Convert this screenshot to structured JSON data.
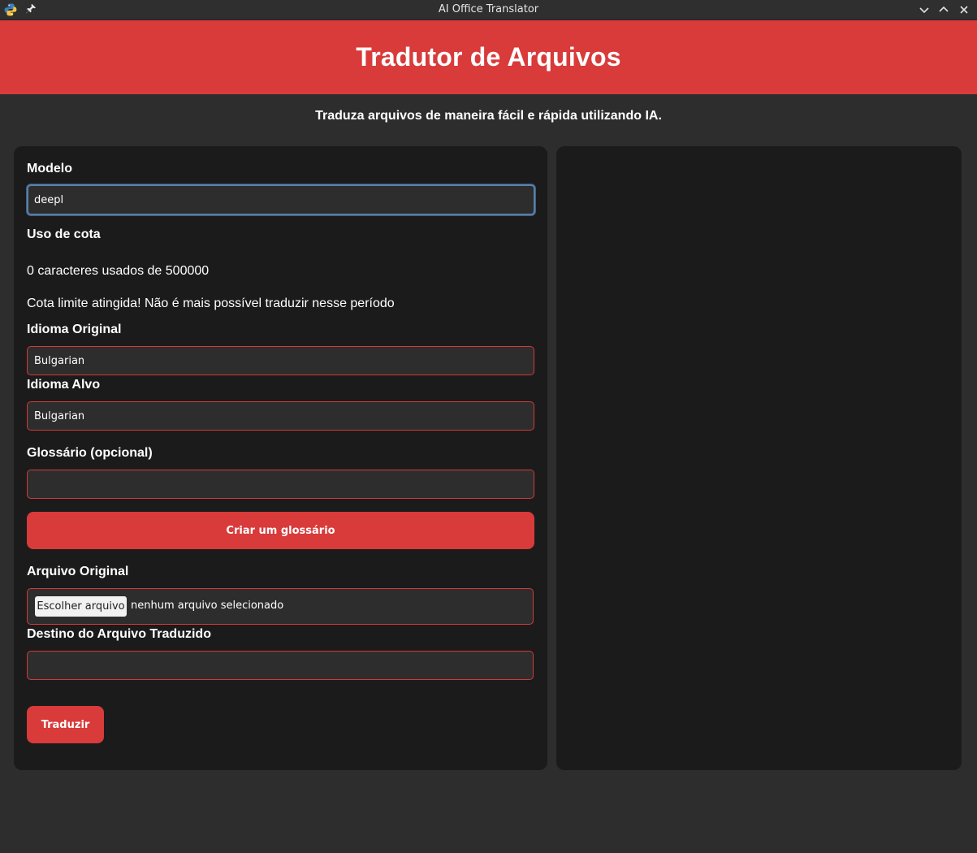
{
  "window": {
    "title": "AI Office Translator",
    "icons": {
      "app": "python-icon",
      "pin": "pin-icon",
      "minimize": "chevron-down-icon",
      "maximize": "chevron-up-icon",
      "close": "close-icon"
    }
  },
  "header": {
    "title": "Tradutor de Arquivos",
    "subtitle": "Traduza arquivos de maneira fácil e rápida utilizando IA."
  },
  "form": {
    "model": {
      "label": "Modelo",
      "value": "deepl"
    },
    "quota": {
      "label": "Uso de cota",
      "usage_text": "0 caracteres usados de 500000",
      "limit_text": "Cota limite atingida! Não é mais possível traduzir nesse período"
    },
    "source_language": {
      "label": "Idioma Original",
      "value": "Bulgarian"
    },
    "target_language": {
      "label": "Idioma Alvo",
      "value": "Bulgarian"
    },
    "glossary": {
      "label": "Glossário (opcional)",
      "value": "",
      "create_button": "Criar um glossário"
    },
    "source_file": {
      "label": "Arquivo Original",
      "choose_button": "Escolher arquivo",
      "status": "nenhum arquivo selecionado"
    },
    "destination": {
      "label": "Destino do Arquivo Traduzido",
      "value": ""
    },
    "translate_button": "Traduzir"
  },
  "colors": {
    "accent": "#d93a3a",
    "background": "#2d2d2d",
    "panel": "#1b1b1b",
    "focus_border": "#5a7fa8"
  }
}
